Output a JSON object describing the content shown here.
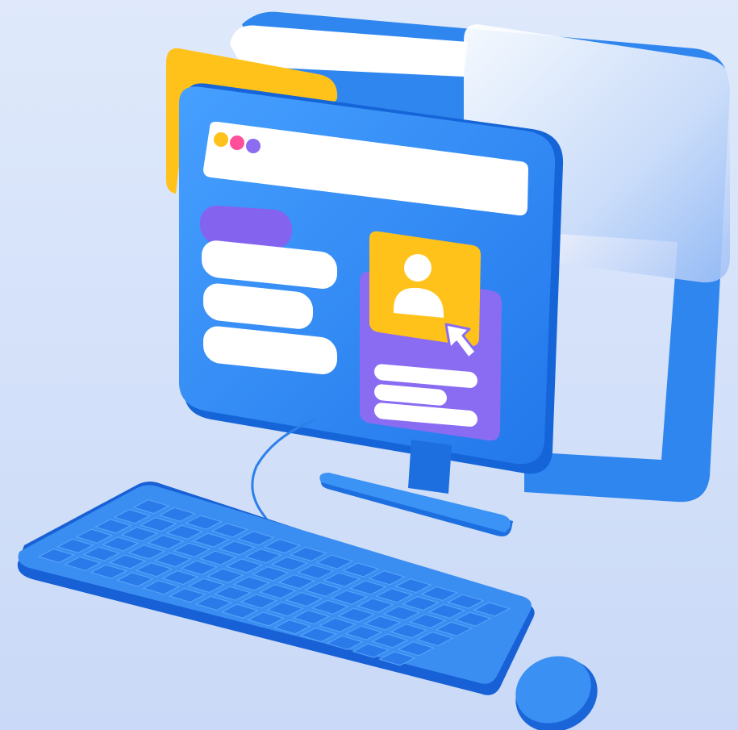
{
  "illustration": {
    "background_top": "#dfe9fb",
    "background_bottom": "#c9d9f7",
    "monitor_blue": "#2f8bf0",
    "monitor_blue_dark": "#1565d8",
    "card_yellow": "#ffc21a",
    "card_purple": "#8a6cf2",
    "pill_purple": "#8464ef",
    "white": "#ffffff",
    "dot_colors": [
      "#ffc21a",
      "#ff4e9a",
      "#8b6cf2"
    ],
    "glass_panel": "#eef2fb",
    "icons": [
      "user-avatar-icon",
      "cursor-arrow-icon"
    ],
    "keyboard": {
      "rows": 6,
      "keys_per_row": 14
    }
  }
}
